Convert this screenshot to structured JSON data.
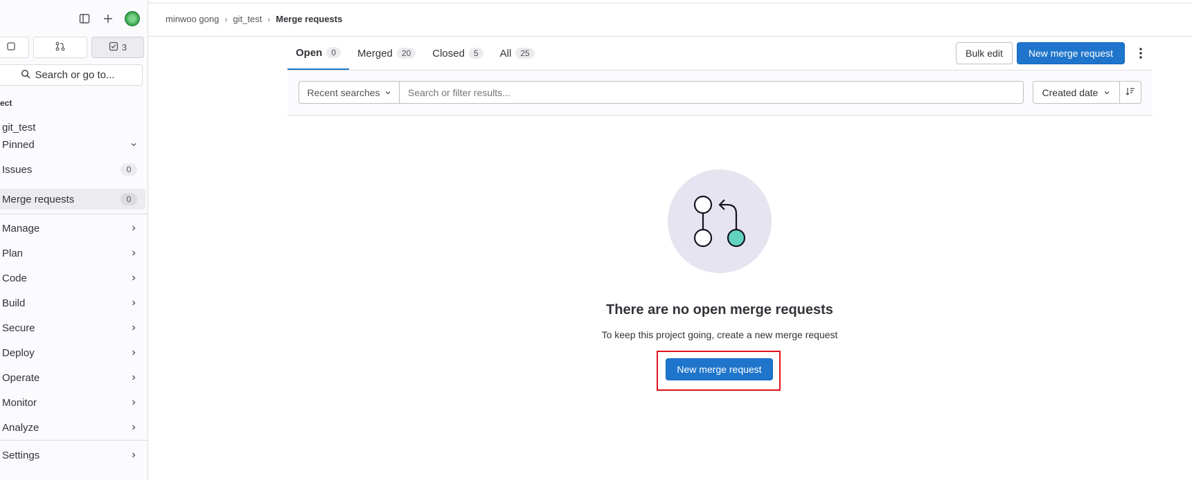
{
  "breadcrumb": {
    "user": "minwoo gong",
    "project": "git_test",
    "current": "Merge requests"
  },
  "sidebar": {
    "counters": {
      "merge_requests_icon": "merge-request-icon",
      "todos": "3"
    },
    "search_label": "Search or go to...",
    "section": "ect",
    "project_name": "git_test",
    "pinned": "Pinned",
    "issues": {
      "label": "Issues",
      "count": "0"
    },
    "merge_requests": {
      "label": "Merge requests",
      "count": "0"
    },
    "menu": [
      "Manage",
      "Plan",
      "Code",
      "Build",
      "Secure",
      "Deploy",
      "Operate",
      "Monitor",
      "Analyze"
    ],
    "settings": "Settings"
  },
  "tabs": [
    {
      "label": "Open",
      "count": "0"
    },
    {
      "label": "Merged",
      "count": "20"
    },
    {
      "label": "Closed",
      "count": "5"
    },
    {
      "label": "All",
      "count": "25"
    }
  ],
  "actions": {
    "bulk_edit": "Bulk edit",
    "new_mr": "New merge request"
  },
  "filter": {
    "recent": "Recent searches",
    "placeholder": "Search or filter results...",
    "sort": "Created date"
  },
  "empty": {
    "title": "There are no open merge requests",
    "description": "To keep this project going, create a new merge request",
    "button": "New merge request"
  },
  "colors": {
    "primary": "#1f75cb",
    "highlight": "#e0101a",
    "illustration_bg": "#e6e4f0",
    "illustration_accent": "#63d3c1"
  }
}
